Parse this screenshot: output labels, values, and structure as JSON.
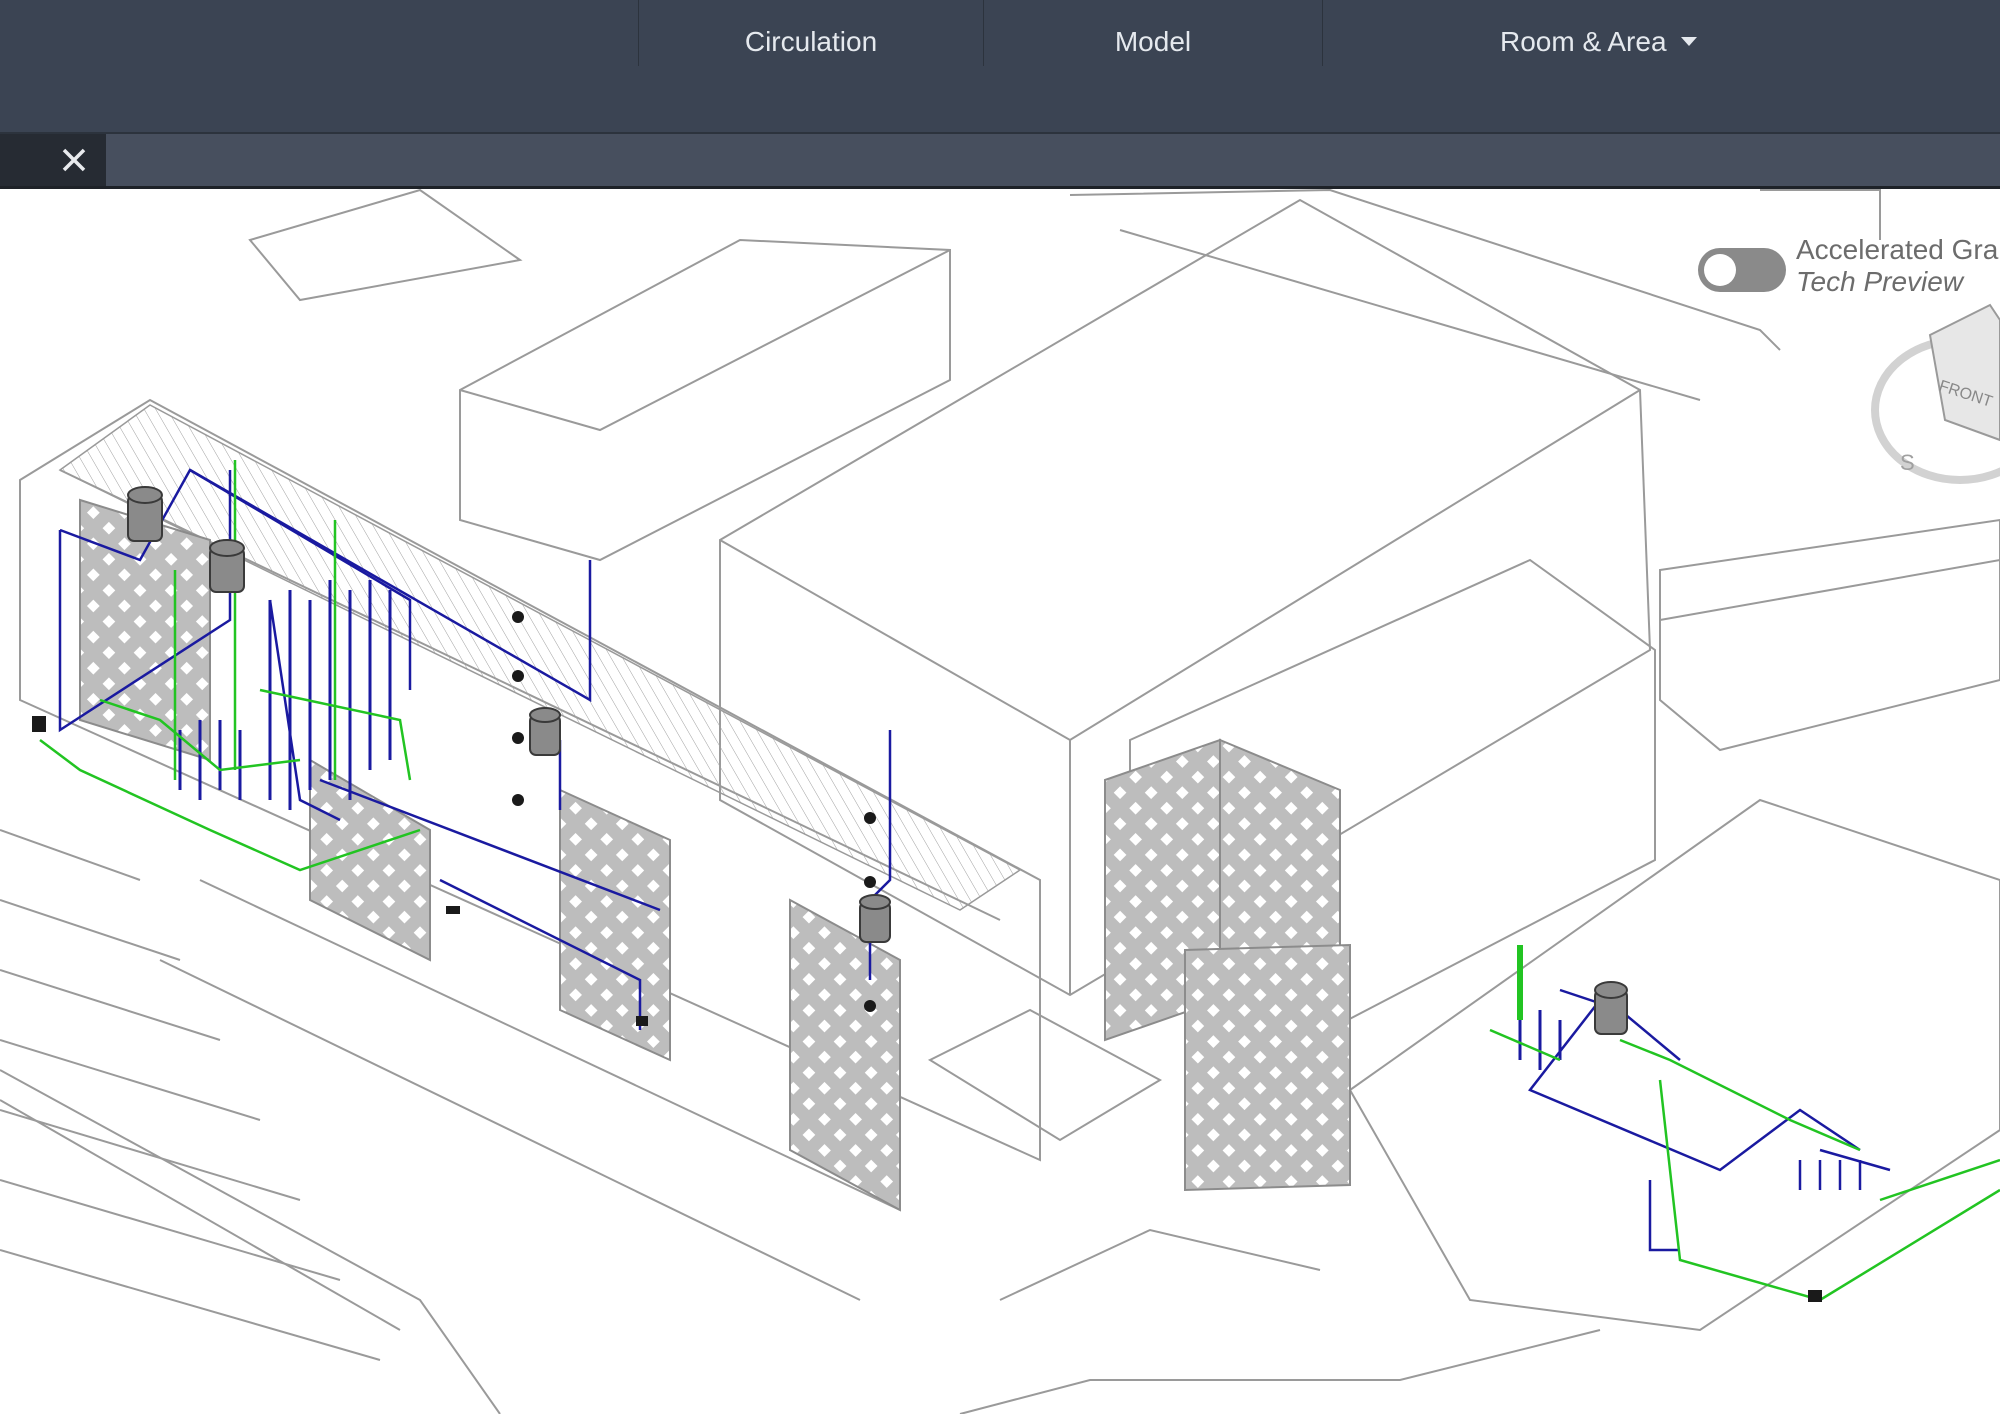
{
  "ribbon": {
    "panels": [
      {
        "label": "Circulation"
      },
      {
        "label": "Model"
      },
      {
        "label": "Room & Area"
      }
    ]
  },
  "document_tab": {
    "close_icon": "close-icon"
  },
  "viewport": {
    "accelerated_graphics": {
      "title": "Accelerated Gra",
      "subtitle": "Tech Preview"
    },
    "viewcube": {
      "face_label": "FRONT"
    }
  },
  "colors": {
    "ribbon_bg": "#3b4453",
    "tabbar_bg": "#474f5e",
    "pipe_blue": "#1a1aa0",
    "pipe_green": "#22c422",
    "model_line": "#9a9a9a"
  }
}
